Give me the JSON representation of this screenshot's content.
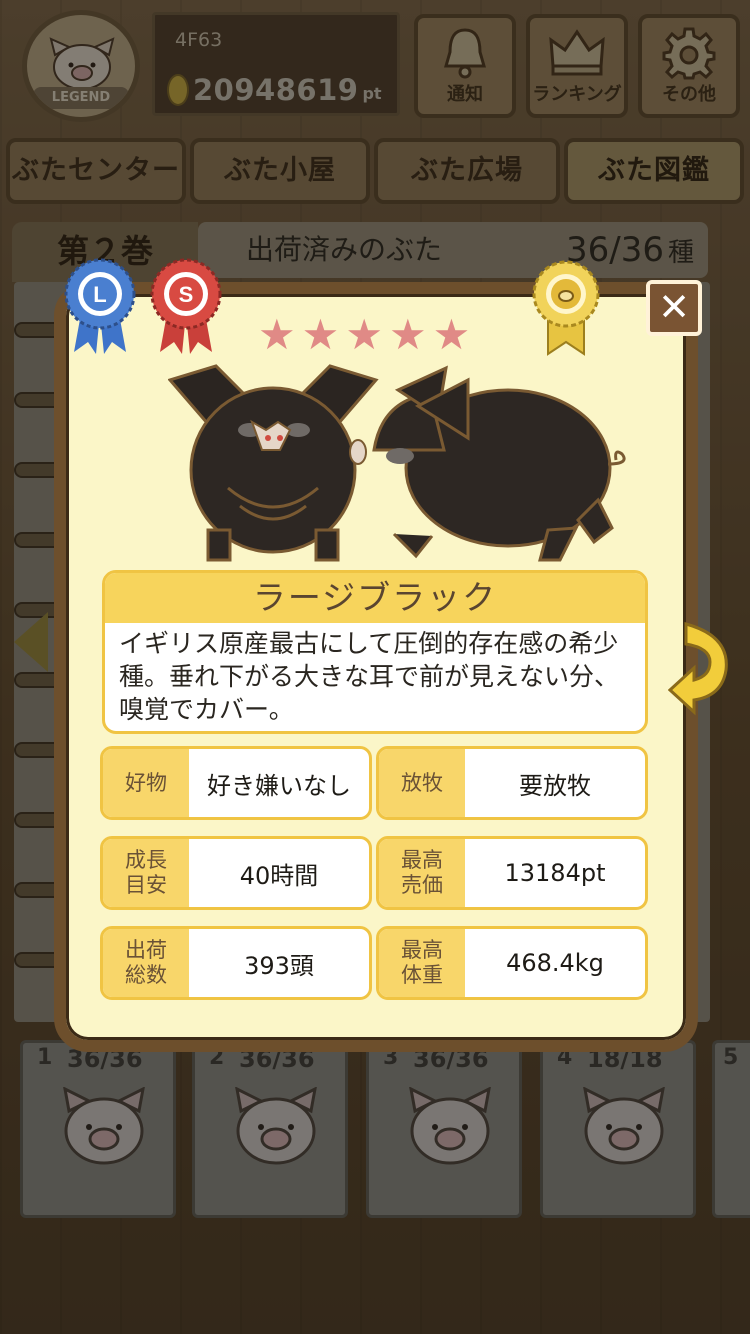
{
  "header": {
    "badge_text": "LEGEND",
    "user_id": "4F63",
    "points": "20948619",
    "points_unit": "pt",
    "buttons": [
      {
        "label": "通知",
        "icon": "bell-icon"
      },
      {
        "label": "ランキング",
        "icon": "crown-icon"
      },
      {
        "label": "その他",
        "icon": "gear-icon"
      }
    ]
  },
  "tabs": [
    {
      "label": "ぶたセンター"
    },
    {
      "label": "ぶた小屋"
    },
    {
      "label": "ぶた広場"
    },
    {
      "label": "ぶた図鑑",
      "active": true
    }
  ],
  "book": {
    "volume": "第２巻",
    "shipped_label": "出荷済みのぶた",
    "shipped_count": "36/36",
    "shipped_unit": "種"
  },
  "modal": {
    "ribbons": [
      {
        "letter": "L",
        "color": "#4a7fd0"
      },
      {
        "letter": "S",
        "color": "#d84a42"
      }
    ],
    "rarity_stars": 5,
    "name": "ラージブラック",
    "description": "イギリス原産最古にして圧倒的存在感の希少種。垂れ下がる大きな耳で前が見えない分、嗅覚でカバー。",
    "stats": [
      {
        "label": "好物",
        "value": "好き嫌いなし"
      },
      {
        "label": "放牧",
        "value": "要放牧"
      },
      {
        "label": "成長\n目安",
        "value": "40時間"
      },
      {
        "label": "最高\n売価",
        "value": "13184pt"
      },
      {
        "label": "出荷\n総数",
        "value": "393頭"
      },
      {
        "label": "最高\n体重",
        "value": "468.4kg"
      }
    ],
    "close_label": "✕"
  },
  "shelf": [
    {
      "num": "1",
      "count": "36/36"
    },
    {
      "num": "2",
      "count": "36/36"
    },
    {
      "num": "3",
      "count": "36/36"
    },
    {
      "num": "4",
      "count": "18/18"
    },
    {
      "num": "5",
      "count": ""
    }
  ]
}
